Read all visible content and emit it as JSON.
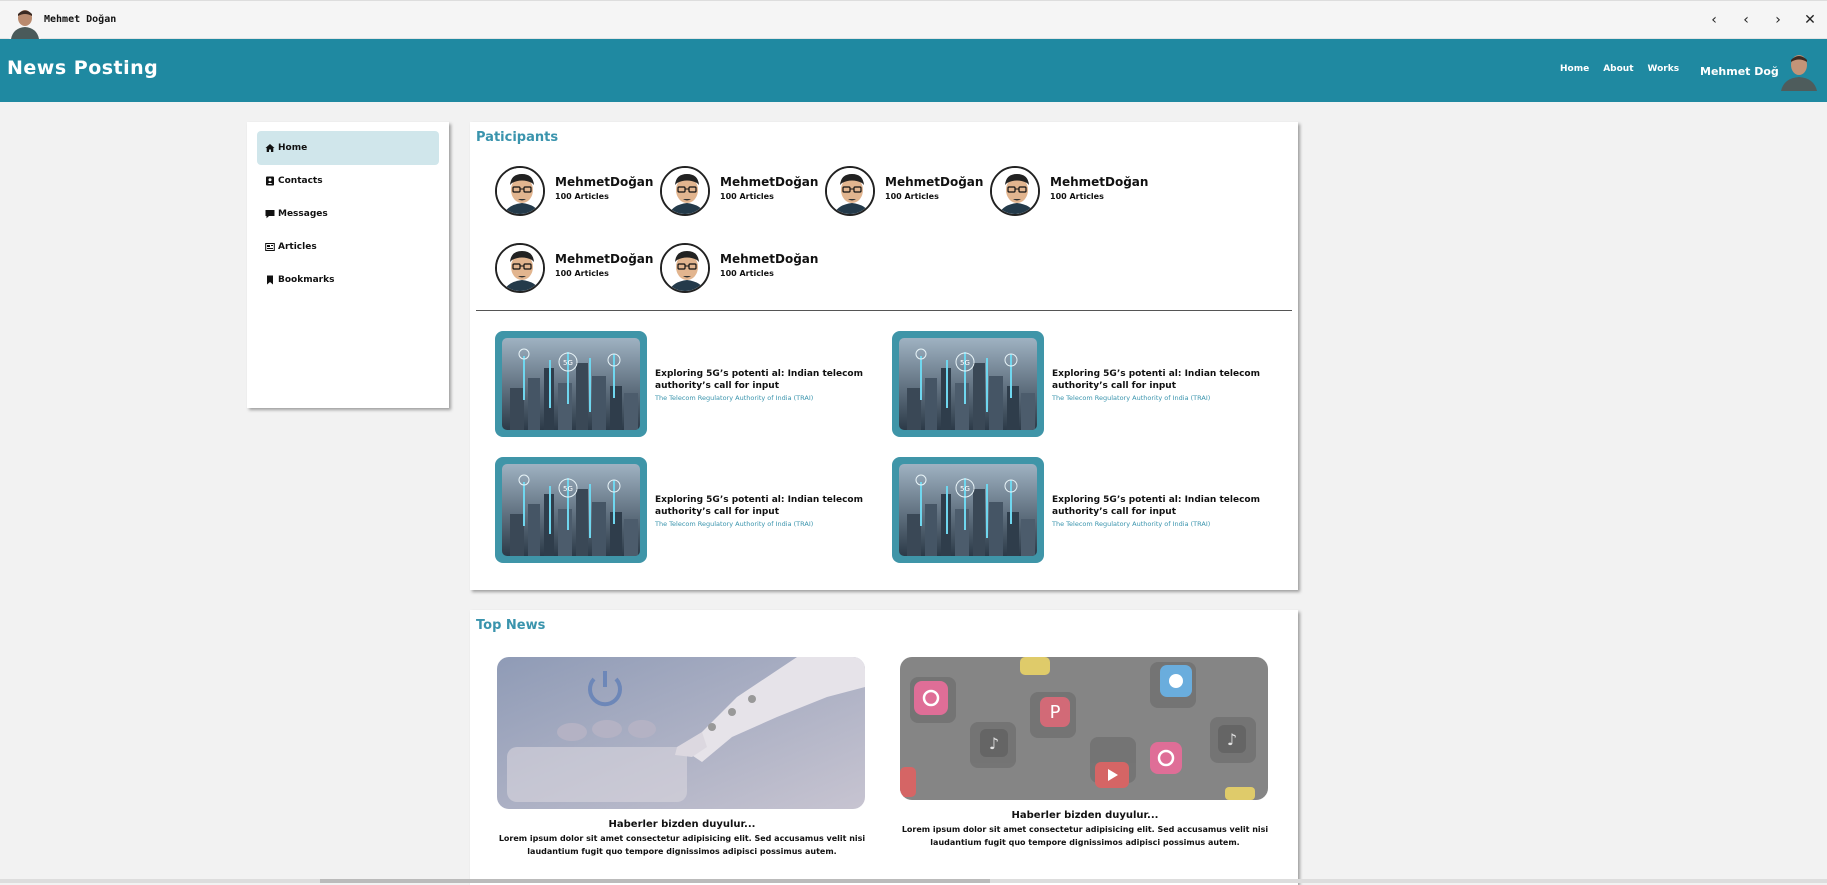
{
  "window": {
    "user_name": "Mehmet Doğan",
    "controls": [
      "‹",
      "‹",
      "›",
      "✕"
    ]
  },
  "header": {
    "brand": "News Posting",
    "nav": [
      "Home",
      "About",
      "Works"
    ],
    "user_name": "Mehmet Doğan"
  },
  "sidebar": {
    "items": [
      {
        "label": "Home",
        "icon": "home-icon",
        "active": true
      },
      {
        "label": "Contacts",
        "icon": "contact-card-icon",
        "active": false
      },
      {
        "label": "Messages",
        "icon": "message-icon",
        "active": false
      },
      {
        "label": "Articles",
        "icon": "newspaper-icon",
        "active": false
      },
      {
        "label": "Bookmarks",
        "icon": "bookmark-icon",
        "active": false
      }
    ]
  },
  "participants": {
    "title": "Paticipants",
    "people": [
      {
        "name": "MehmetDoğan",
        "articles": "100 Articles"
      },
      {
        "name": "MehmetDoğan",
        "articles": "100 Articles"
      },
      {
        "name": "MehmetDoğan",
        "articles": "100 Articles"
      },
      {
        "name": "MehmetDoğan",
        "articles": "100 Articles"
      },
      {
        "name": "MehmetDoğan",
        "articles": "100 Articles"
      },
      {
        "name": "MehmetDoğan",
        "articles": "100 Articles"
      }
    ]
  },
  "articles": [
    {
      "title": "Exploring 5G’s potenti al: Indian telecom authority’s call for input",
      "source": "The Telecom Regulatory Authority of India (TRAI)"
    },
    {
      "title": "Exploring 5G’s potenti al: Indian telecom authority’s call for input",
      "source": "The Telecom Regulatory Authority of India (TRAI)"
    },
    {
      "title": "Exploring 5G’s potenti al: Indian telecom authority’s call for input",
      "source": "The Telecom Regulatory Authority of India (TRAI)"
    },
    {
      "title": "Exploring 5G’s potenti al: Indian telecom authority’s call for input",
      "source": "The Telecom Regulatory Authority of India (TRAI)"
    }
  ],
  "top_news": {
    "title": "Top News",
    "items": [
      {
        "heading": "Haberler bizden duyulur...",
        "text": "Lorem ipsum dolor sit amet consectetur adipisicing elit. Sed accusamus velit nisi laudantium fugit quo tempore dignissimos adipisci possimus autem."
      },
      {
        "heading": "Haberler bizden duyulur...",
        "text": "Lorem ipsum dolor sit amet consectetur adipisicing elit. Sed accusamus velit nisi laudantium fugit quo tempore dignissimos adipisci possimus autem."
      }
    ]
  },
  "colors": {
    "accent": "#1f89a1",
    "title": "#3a94ad",
    "active_bg": "#d0e6eb"
  }
}
